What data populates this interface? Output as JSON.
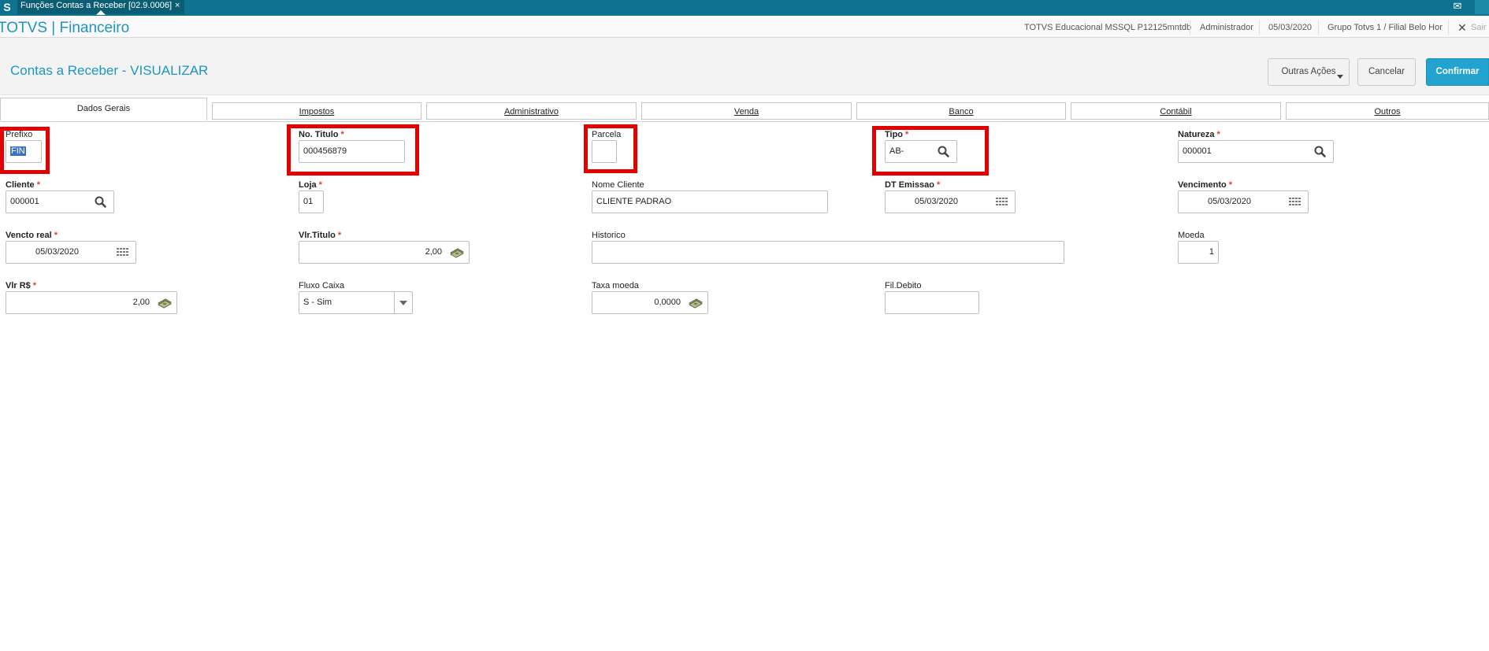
{
  "window": {
    "tab_title": "Funções Contas a Receber [02.9.0006]",
    "tab_close": "×"
  },
  "header": {
    "app_title": "TOTVS | Financeiro",
    "environment": "TOTVS Educacional MSSQL P12125mntdb",
    "user": "Administrador",
    "date": "05/03/2020",
    "branch": "Grupo Totvs 1 / Filial Belo Hor",
    "exit_label": "Sair"
  },
  "page": {
    "title": "Contas a Receber - VISUALIZAR",
    "actions": {
      "more": "Outras Ações",
      "cancel": "Cancelar",
      "confirm": "Confirmar"
    }
  },
  "tabs": [
    "Dados Gerais",
    "Impostos",
    "Administrativo",
    "Venda",
    "Banco",
    "Contábil",
    "Outros"
  ],
  "form": {
    "prefixo": {
      "label": "Prefixo",
      "value": "FIN"
    },
    "no_titulo": {
      "label": "No. Titulo",
      "value": "000456879"
    },
    "parcela": {
      "label": "Parcela",
      "value": ""
    },
    "tipo": {
      "label": "Tipo",
      "value": "AB-"
    },
    "natureza": {
      "label": "Natureza",
      "value": "000001"
    },
    "cliente": {
      "label": "Cliente",
      "value": "000001"
    },
    "loja": {
      "label": "Loja",
      "value": "01"
    },
    "nome_cliente": {
      "label": "Nome Cliente",
      "value": "CLIENTE PADRAO"
    },
    "dt_emissao": {
      "label": "DT Emissao",
      "value": "05/03/2020"
    },
    "vencimento": {
      "label": "Vencimento",
      "value": "05/03/2020"
    },
    "vencto_real": {
      "label": "Vencto real",
      "value": "05/03/2020"
    },
    "vlr_titulo": {
      "label": "Vlr.Titulo",
      "value": "2,00"
    },
    "historico": {
      "label": "Historico",
      "value": ""
    },
    "moeda": {
      "label": "Moeda",
      "value": "1"
    },
    "vlr_rs": {
      "label": "Vlr R$",
      "value": "2,00"
    },
    "fluxo_caixa": {
      "label": "Fluxo Caixa",
      "value": "S - Sim"
    },
    "taxa_moeda": {
      "label": "Taxa moeda",
      "value": "0,0000"
    },
    "fil_debito": {
      "label": "Fil.Debito",
      "value": ""
    }
  },
  "required_marker": "*",
  "colors": {
    "topbar": "#0f7390",
    "accent": "#1c96c0",
    "confirm_button": "#23a3cf",
    "highlight_box": "#e50000",
    "required": "#e53935"
  }
}
